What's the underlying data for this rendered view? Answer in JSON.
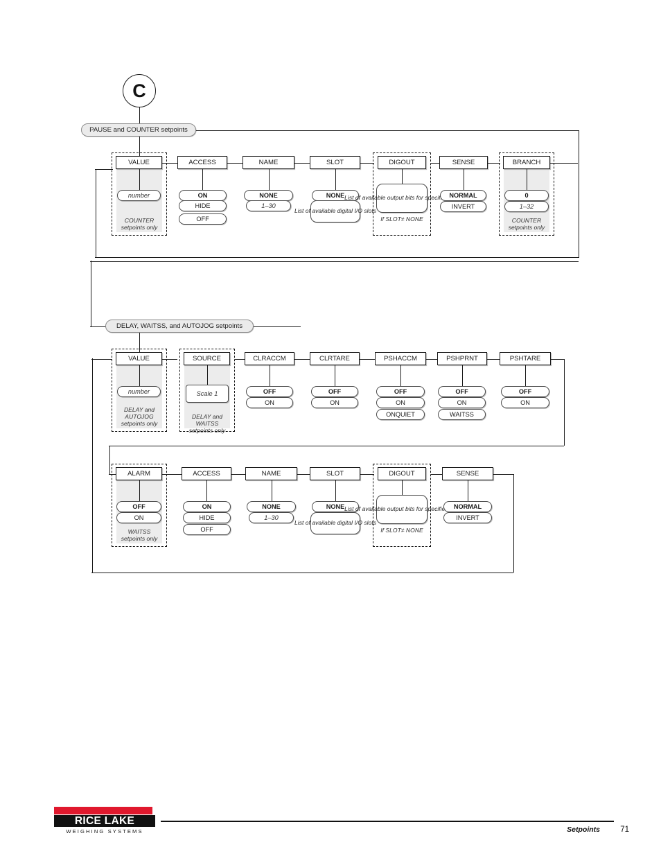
{
  "page": {
    "connector_marker": "C",
    "footer": {
      "brand_name": "RICE LAKE",
      "brand_tagline": "WEIGHING SYSTEMS",
      "section": "Setpoints",
      "page_number": "71"
    },
    "colors": {
      "brand_red": "#e0182d",
      "line": "#1a1a1a",
      "shade": "#ececec",
      "capsule_fill": "#ebebeb"
    }
  },
  "sections": [
    {
      "id": "pause-counter",
      "header": {
        "prefix": "PAUSE ",
        "italic1": "and ",
        "mid": "COUNTER ",
        "italic2": "setpoints",
        "full": "PAUSE and COUNTER setpoints"
      },
      "params": [
        {
          "name": "VALUE",
          "optional": true,
          "values": [
            {
              "text": "number",
              "style": "italic"
            }
          ],
          "caption": "COUNTER\nsetpoints only"
        },
        {
          "name": "ACCESS",
          "optional": false,
          "values": [
            {
              "text": "ON",
              "style": "bold"
            },
            {
              "text": "HIDE",
              "style": "normal"
            },
            {
              "text": "OFF",
              "style": "normal"
            }
          ],
          "caption": ""
        },
        {
          "name": "NAME",
          "optional": false,
          "values": [
            {
              "text": "NONE",
              "style": "bold"
            },
            {
              "text": "1–30",
              "style": "italic"
            }
          ],
          "caption": ""
        },
        {
          "name": "SLOT",
          "optional": false,
          "values": [
            {
              "text": "NONE",
              "style": "bold"
            },
            {
              "text": "List of available\ndigital I/O slots",
              "style": "multi"
            }
          ],
          "caption": ""
        },
        {
          "name": "DIGOUT",
          "optional": true,
          "values": [
            {
              "text": "List of available\noutput bits for\nspecified slot",
              "style": "multi"
            }
          ],
          "caption": "If SLOT≠ NONE"
        },
        {
          "name": "SENSE",
          "optional": false,
          "values": [
            {
              "text": "NORMAL",
              "style": "bold"
            },
            {
              "text": "INVERT",
              "style": "normal"
            }
          ],
          "caption": ""
        },
        {
          "name": "BRANCH",
          "optional": true,
          "values": [
            {
              "text": "0",
              "style": "bold"
            },
            {
              "text": "1–32",
              "style": "italic"
            }
          ],
          "caption": "COUNTER\nsetpoints only"
        }
      ]
    },
    {
      "id": "delay-waitss-autojog",
      "header": {
        "full": "DELAY, WAITSS, and AUTOJOG setpoints"
      },
      "params_row1": [
        {
          "name": "VALUE",
          "optional": true,
          "values": [
            {
              "text": "number",
              "style": "italic"
            }
          ],
          "caption": "DELAY and\nAUTOJOG\nsetpoints only"
        },
        {
          "name": "SOURCE",
          "optional": true,
          "values": [
            {
              "text": "Scale 1",
              "style": "italic-rect"
            }
          ],
          "caption": "DELAY and\nWAITSS\nsetpoints only"
        },
        {
          "name": "CLRACCM",
          "optional": false,
          "values": [
            {
              "text": "OFF",
              "style": "bold"
            },
            {
              "text": "ON",
              "style": "normal"
            }
          ],
          "caption": ""
        },
        {
          "name": "CLRTARE",
          "optional": false,
          "values": [
            {
              "text": "OFF",
              "style": "bold"
            },
            {
              "text": "ON",
              "style": "normal"
            }
          ],
          "caption": ""
        },
        {
          "name": "PSHACCM",
          "optional": false,
          "values": [
            {
              "text": "OFF",
              "style": "bold"
            },
            {
              "text": "ON",
              "style": "normal"
            },
            {
              "text": "ONQUIET",
              "style": "normal"
            }
          ],
          "caption": ""
        },
        {
          "name": "PSHPRNT",
          "optional": false,
          "values": [
            {
              "text": "OFF",
              "style": "bold"
            },
            {
              "text": "ON",
              "style": "normal"
            },
            {
              "text": "WAITSS",
              "style": "normal"
            }
          ],
          "caption": ""
        },
        {
          "name": "PSHTARE",
          "optional": false,
          "values": [
            {
              "text": "OFF",
              "style": "bold"
            },
            {
              "text": "ON",
              "style": "normal"
            }
          ],
          "caption": ""
        }
      ],
      "params_row2": [
        {
          "name": "ALARM",
          "optional": true,
          "values": [
            {
              "text": "OFF",
              "style": "bold"
            },
            {
              "text": "ON",
              "style": "normal"
            }
          ],
          "caption": "WAITSS\nsetpoints only"
        },
        {
          "name": "ACCESS",
          "optional": false,
          "values": [
            {
              "text": "ON",
              "style": "bold"
            },
            {
              "text": "HIDE",
              "style": "normal"
            },
            {
              "text": "OFF",
              "style": "normal"
            }
          ],
          "caption": ""
        },
        {
          "name": "NAME",
          "optional": false,
          "values": [
            {
              "text": "NONE",
              "style": "bold"
            },
            {
              "text": "1–30",
              "style": "italic"
            }
          ],
          "caption": ""
        },
        {
          "name": "SLOT",
          "optional": false,
          "values": [
            {
              "text": "NONE",
              "style": "bold"
            },
            {
              "text": "List of available\ndigital I/O slots",
              "style": "multi"
            }
          ],
          "caption": ""
        },
        {
          "name": "DIGOUT",
          "optional": true,
          "values": [
            {
              "text": "List of available\noutput bits for\nspecified slot",
              "style": "multi"
            }
          ],
          "caption": "If SLOT≠ NONE"
        },
        {
          "name": "SENSE",
          "optional": false,
          "values": [
            {
              "text": "NORMAL",
              "style": "bold"
            },
            {
              "text": "INVERT",
              "style": "normal"
            }
          ],
          "caption": ""
        }
      ]
    }
  ]
}
